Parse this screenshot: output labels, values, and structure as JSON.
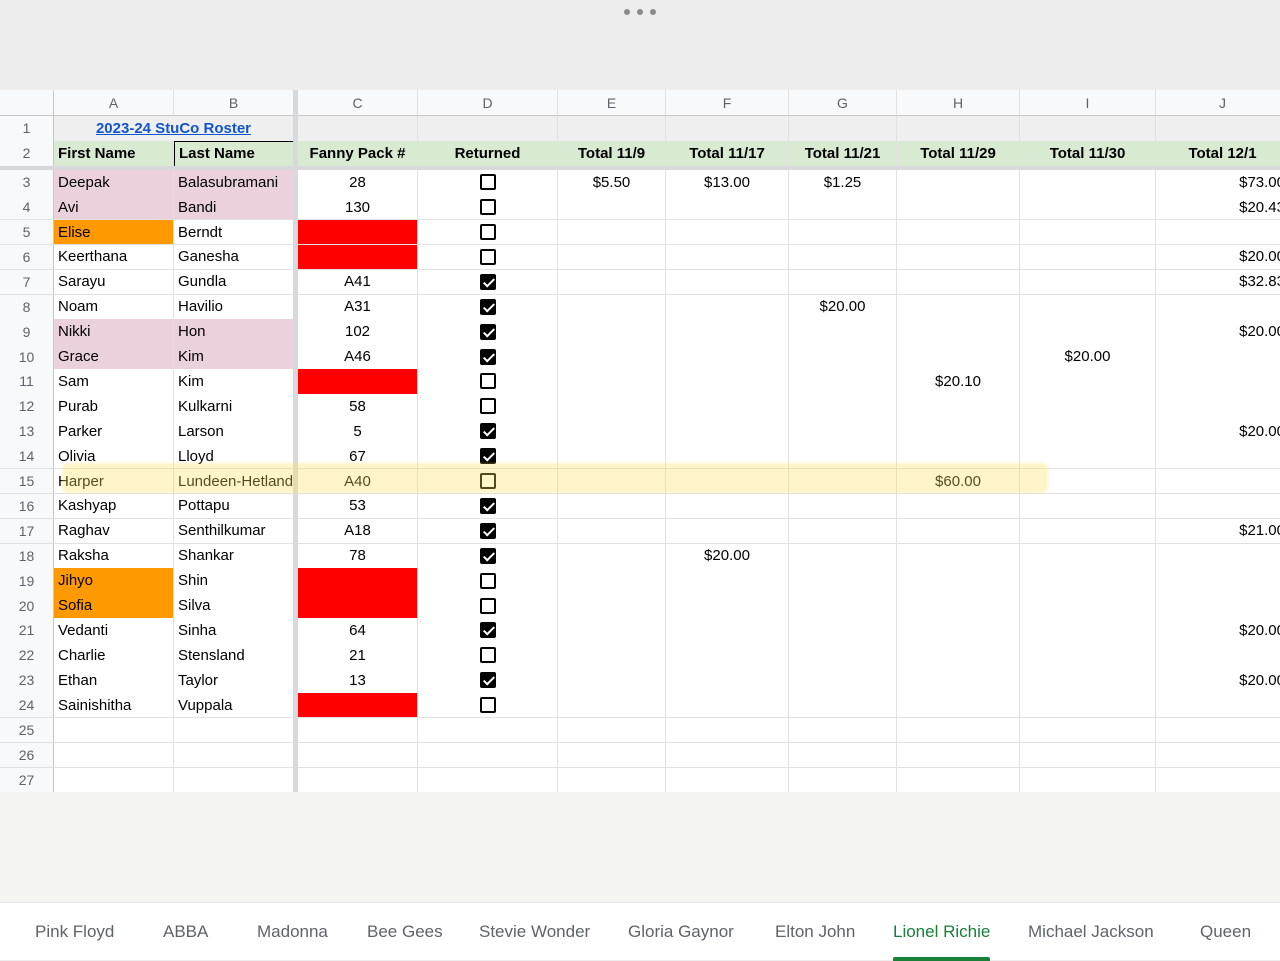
{
  "columns": [
    "A",
    "B",
    "C",
    "D",
    "E",
    "F",
    "G",
    "H",
    "I",
    "J"
  ],
  "title_link": "2023-24 StuCo Roster",
  "headers": [
    "First Name",
    "Last Name",
    "Fanny Pack #",
    "Returned",
    "Total 11/9",
    "Total 11/17",
    "Total 11/21",
    "Total 11/29",
    "Total 11/30",
    "Total 12/1"
  ],
  "rows": [
    {
      "first": "Deepak",
      "last": "Balasubramani",
      "pack": "28",
      "returned": false,
      "totals": [
        "$5.50",
        "$13.00",
        "$1.25",
        "",
        "",
        "$73.00"
      ],
      "first_bg": "pink",
      "last_bg": "pink",
      "pack_bg": ""
    },
    {
      "first": "Avi",
      "last": "Bandi",
      "pack": "130",
      "returned": false,
      "totals": [
        "",
        "",
        "",
        "",
        "",
        "$20.43"
      ],
      "first_bg": "pink",
      "last_bg": "pink",
      "pack_bg": ""
    },
    {
      "first": "Elise",
      "last": "Berndt",
      "pack": "",
      "returned": false,
      "totals": [
        "",
        "",
        "",
        "",
        "",
        ""
      ],
      "first_bg": "orange",
      "last_bg": "",
      "pack_bg": "red"
    },
    {
      "first": "Keerthana",
      "last": "Ganesha",
      "pack": "",
      "returned": false,
      "totals": [
        "",
        "",
        "",
        "",
        "",
        "$20.00"
      ],
      "first_bg": "",
      "last_bg": "",
      "pack_bg": "red"
    },
    {
      "first": "Sarayu",
      "last": "Gundla",
      "pack": "A41",
      "returned": true,
      "totals": [
        "",
        "",
        "",
        "",
        "",
        "$32.83"
      ],
      "first_bg": "",
      "last_bg": "",
      "pack_bg": ""
    },
    {
      "first": "Noam",
      "last": "Havilio",
      "pack": "A31",
      "returned": true,
      "totals": [
        "",
        "",
        "$20.00",
        "",
        "",
        ""
      ],
      "first_bg": "",
      "last_bg": "",
      "pack_bg": ""
    },
    {
      "first": "Nikki",
      "last": "Hon",
      "pack": "102",
      "returned": true,
      "totals": [
        "",
        "",
        "",
        "",
        "",
        "$20.00"
      ],
      "first_bg": "pink",
      "last_bg": "pink",
      "pack_bg": ""
    },
    {
      "first": "Grace",
      "last": "Kim",
      "pack": "A46",
      "returned": true,
      "totals": [
        "",
        "",
        "",
        "",
        "$20.00",
        ""
      ],
      "first_bg": "pink",
      "last_bg": "pink",
      "pack_bg": ""
    },
    {
      "first": "Sam",
      "last": "Kim",
      "pack": "",
      "returned": false,
      "totals": [
        "",
        "",
        "",
        "$20.10",
        "",
        ""
      ],
      "first_bg": "",
      "last_bg": "",
      "pack_bg": "red"
    },
    {
      "first": "Purab",
      "last": "Kulkarni",
      "pack": "58",
      "returned": false,
      "totals": [
        "",
        "",
        "",
        "",
        "",
        ""
      ],
      "first_bg": "",
      "last_bg": "",
      "pack_bg": ""
    },
    {
      "first": "Parker",
      "last": "Larson",
      "pack": "5",
      "returned": true,
      "totals": [
        "",
        "",
        "",
        "",
        "",
        "$20.00"
      ],
      "first_bg": "",
      "last_bg": "",
      "pack_bg": ""
    },
    {
      "first": "Olivia",
      "last": "Lloyd",
      "pack": "67",
      "returned": true,
      "totals": [
        "",
        "",
        "",
        "",
        "",
        ""
      ],
      "first_bg": "",
      "last_bg": "",
      "pack_bg": ""
    },
    {
      "first": "Harper",
      "last": "Lundeen-Hetland",
      "pack": "A40",
      "returned": false,
      "totals": [
        "",
        "",
        "",
        "$60.00",
        "",
        ""
      ],
      "first_bg": "",
      "last_bg": "",
      "pack_bg": ""
    },
    {
      "first": "Kashyap",
      "last": "Pottapu",
      "pack": "53",
      "returned": true,
      "totals": [
        "",
        "",
        "",
        "",
        "",
        ""
      ],
      "first_bg": "",
      "last_bg": "",
      "pack_bg": ""
    },
    {
      "first": "Raghav",
      "last": "Senthilkumar",
      "pack": "A18",
      "returned": true,
      "totals": [
        "",
        "",
        "",
        "",
        "",
        "$21.00"
      ],
      "first_bg": "",
      "last_bg": "",
      "pack_bg": ""
    },
    {
      "first": "Raksha",
      "last": "Shankar",
      "pack": "78",
      "returned": true,
      "totals": [
        "",
        "$20.00",
        "",
        "",
        "",
        ""
      ],
      "first_bg": "",
      "last_bg": "",
      "pack_bg": ""
    },
    {
      "first": "Jihyo",
      "last": "Shin",
      "pack": "",
      "returned": false,
      "totals": [
        "",
        "",
        "",
        "",
        "",
        ""
      ],
      "first_bg": "orange",
      "last_bg": "",
      "pack_bg": "red"
    },
    {
      "first": "Sofia",
      "last": "Silva",
      "pack": "",
      "returned": false,
      "totals": [
        "",
        "",
        "",
        "",
        "",
        ""
      ],
      "first_bg": "orange",
      "last_bg": "",
      "pack_bg": "red"
    },
    {
      "first": "Vedanti",
      "last": "Sinha",
      "pack": "64",
      "returned": true,
      "totals": [
        "",
        "",
        "",
        "",
        "",
        "$20.00"
      ],
      "first_bg": "",
      "last_bg": "",
      "pack_bg": ""
    },
    {
      "first": "Charlie",
      "last": "Stensland",
      "pack": "21",
      "returned": false,
      "totals": [
        "",
        "",
        "",
        "",
        "",
        ""
      ],
      "first_bg": "",
      "last_bg": "",
      "pack_bg": ""
    },
    {
      "first": "Ethan",
      "last": "Taylor",
      "pack": "13",
      "returned": true,
      "totals": [
        "",
        "",
        "",
        "",
        "",
        "$20.00"
      ],
      "first_bg": "",
      "last_bg": "",
      "pack_bg": ""
    },
    {
      "first": "Sainishitha",
      "last": "Vuppala",
      "pack": "",
      "returned": false,
      "totals": [
        "",
        "",
        "",
        "",
        "",
        ""
      ],
      "first_bg": "",
      "last_bg": "",
      "pack_bg": "red"
    }
  ],
  "row_count": 27,
  "highlighted_row_number": 15,
  "sheet_tabs": [
    "Pink Floyd",
    "ABBA",
    "Madonna",
    "Bee Gees",
    "Stevie Wonder",
    "Gloria Gaynor",
    "Elton John",
    "Lionel Richie",
    "Michael Jackson",
    "Queen"
  ],
  "active_tab": "Lionel Richie",
  "colors": {
    "header_green": "#d9ead3",
    "pink": "#ead1dc",
    "orange": "#ff9900",
    "red": "#ff0000",
    "active_tab": "#188038",
    "link": "#1155cc"
  }
}
